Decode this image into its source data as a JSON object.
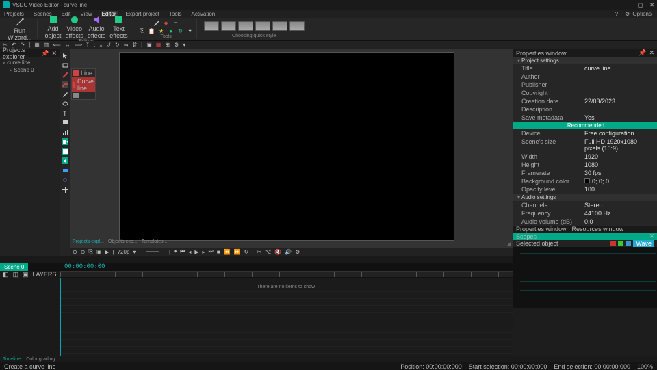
{
  "title": "VSDC Video Editor - curve line",
  "menu": [
    "Projects",
    "Scenes",
    "Edit",
    "View",
    "Editor",
    "Export project",
    "Tools",
    "Activation"
  ],
  "menu_active": 4,
  "toolbar_right": {
    "help": "?",
    "options": "Options"
  },
  "ribbon": {
    "wizard": "Run\nWizard...",
    "add": "Add\nobject",
    "video": "Video\neffects",
    "audio": "Audio\neffects",
    "text": "Text\neffects",
    "editing": "Editing",
    "tools": "Tools",
    "style": "Choosing quick style"
  },
  "left_panel": {
    "title": "Projects explorer",
    "items": [
      "curve line",
      "Scene 0"
    ]
  },
  "popup": [
    {
      "label": "Line",
      "sel": false,
      "sw": "#c44"
    },
    {
      "label": "Curve line",
      "sel": true,
      "sw": "#c44"
    },
    {
      "label": "",
      "sel": false,
      "sw": "#888"
    }
  ],
  "canvas_tabs": [
    "Projects expl...",
    "Objects exp...",
    "Templates..."
  ],
  "canvas_controls": {
    "res": "720p",
    "down": "▾"
  },
  "properties": {
    "title": "Properties window",
    "section1": "Project settings",
    "rows1": [
      [
        "Title",
        "curve line"
      ],
      [
        "Author",
        ""
      ],
      [
        "Publisher",
        ""
      ],
      [
        "Copyright",
        ""
      ],
      [
        "Creation date",
        "22/03/2023"
      ],
      [
        "Description",
        ""
      ],
      [
        "Save metadata",
        "Yes"
      ]
    ],
    "green_band": "Recommended",
    "rows2": [
      [
        "Device",
        "Free configuration"
      ],
      [
        "Scene's size",
        "Full HD 1920x1080 pixels (16:9)"
      ],
      [
        "Width",
        "1920"
      ],
      [
        "Height",
        "1080"
      ],
      [
        "Framerate",
        "30 fps"
      ],
      [
        "Background color",
        "0; 0; 0"
      ],
      [
        "Opacity level",
        "100"
      ]
    ],
    "section2": "Audio settings",
    "rows3": [
      [
        "Channels",
        "Stereo"
      ],
      [
        "Frequency",
        "44100 Hz"
      ],
      [
        "Audio volume (dB)",
        "0.0"
      ]
    ],
    "bottom_tabs": [
      "Properties window",
      "Resources window"
    ]
  },
  "scopes": {
    "title": "Scopes",
    "sel": "Selected object",
    "mode": "Wave"
  },
  "timeline": {
    "scene": "Scene 0",
    "tc": "00:00:00:00",
    "empty": "There are no items to show.",
    "layers": [
      "◧",
      "◫",
      "▣",
      "LAYERS"
    ]
  },
  "bottom_tabs": [
    "Timeline",
    "Color grading"
  ],
  "status": {
    "left": "Create a curve line",
    "pos": "Position:   00:00:00:000",
    "start": "Start selection:   00:00:00:000",
    "end": "End selection:   00:00:00:000",
    "zoom": "100%"
  }
}
